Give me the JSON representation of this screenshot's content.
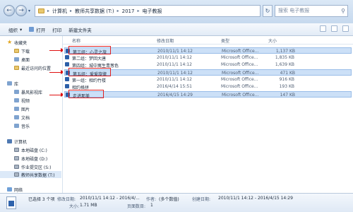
{
  "address_bar": {
    "crumbs": [
      "计算机",
      "教师共享数据 (T:)",
      "2017",
      "电子教报"
    ],
    "search_placeholder": "搜索 电子教报"
  },
  "toolbar": {
    "organize": "组织",
    "open": "打开",
    "print": "打印",
    "new_folder": "新建文件夹"
  },
  "nav": {
    "favorites": "收藏夹",
    "favorites_items": [
      "下载",
      "桌面",
      "最近访问的位置"
    ],
    "libraries": "库",
    "library_items": [
      "暴风影视库",
      "视频",
      "图片",
      "文档",
      "音乐"
    ],
    "computer": "计算机",
    "drives": [
      "本地磁盘 (C:)",
      "本地磁盘 (D:)",
      "作业提交区 (S:)",
      "教师共享数据 (T:)"
    ],
    "network": "网络"
  },
  "list": {
    "headers": {
      "name": "名称",
      "date": "修改日期",
      "type": "类型",
      "size": "大小"
    },
    "files": [
      {
        "name": "第三组：心灵之旅",
        "date": "2010/11/1 14:12",
        "type": "Microsoft Office...",
        "size": "1,137 KB",
        "selected": true
      },
      {
        "name": "第二组：梦回大唐",
        "date": "2010/11/1 14:12",
        "type": "Microsoft Office...",
        "size": "1,835 KB",
        "selected": false
      },
      {
        "name": "第四组：城中寓生青葱色",
        "date": "2010/11/1 14:12",
        "type": "Microsoft Office...",
        "size": "1,639 KB",
        "selected": false
      },
      {
        "name": "第五组：爱爱旋律",
        "date": "2010/11/1 14:12",
        "type": "Microsoft Office...",
        "size": "471 KB",
        "selected": true
      },
      {
        "name": "第一组：相约竹楼",
        "date": "2010/11/1 14:12",
        "type": "Microsoft Office...",
        "size": "916 KB",
        "selected": false
      },
      {
        "name": "相约格拼",
        "date": "2016/4/14 15:51",
        "type": "Microsoft Office...",
        "size": "193 KB",
        "selected": false
      },
      {
        "name": "走进那美",
        "date": "2016/4/15 14:29",
        "type": "Microsoft Office...",
        "size": "147 KB",
        "selected": true
      }
    ]
  },
  "details": {
    "selected": "已选择 3 个项",
    "modified_label": "修改日期:",
    "modified_value": "2010/11/1 14:12 - 2016/4/...",
    "authors_label": "作者:",
    "authors_value": "(多个数值)",
    "created_label": "创建日期:",
    "created_value": "2010/11/1 14:12 - 2016/4/15 14:29",
    "size_label": "大小:",
    "size_value": "1.71 MB",
    "pages_label": "页面数目:",
    "pages_value": "1"
  },
  "colors": {
    "accent": "#cce0f7",
    "annotation": "#e02020"
  }
}
